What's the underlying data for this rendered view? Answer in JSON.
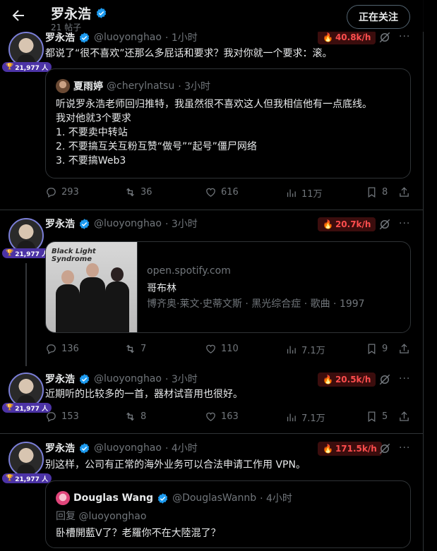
{
  "header": {
    "title": "罗永浩",
    "post_count": "21 帖子",
    "follow_label": "正在关注"
  },
  "colors": {
    "verified": "#1d9bf0",
    "hot_text": "#ff4d4d",
    "badge": "#4c33a6"
  },
  "tweets": [
    {
      "name": "罗永浩",
      "handle": "@luoyonghao",
      "time": "· 1小时",
      "hot": "40.8k/h",
      "badge": "21,977 人",
      "text": "都说了“很不喜欢”还那么多屁话和要求？我对你就一个要求：滚。",
      "quote": {
        "name": "夏雨婷",
        "handle": "@cherylnatsu",
        "time": "· 3小时",
        "lines": [
          "听说罗永浩老师回归推特，我虽然很不喜欢这人但我相信他有一点底线。",
          "我对他就3个要求",
          "1. 不要卖中转站",
          "2. 不要搞互关互粉互赞“做号”“起号”僵尸网络",
          "3. 不要搞Web3"
        ]
      },
      "stats": {
        "replies": "293",
        "retweets": "36",
        "likes": "616",
        "views": "11万"
      }
    },
    {
      "name": "罗永浩",
      "handle": "@luoyonghao",
      "time": "· 3小时",
      "hot": "20.7k/h",
      "badge": "21,977 人",
      "card": {
        "domain": "open.spotify.com",
        "title": "哥布林",
        "desc": "博齐奥·莱文·史蒂文斯 · 黑光综合症 · 歌曲 · 1997",
        "cover_text": "Black Light Syndrome"
      },
      "stats": {
        "replies": "136",
        "retweets": "7",
        "likes": "110",
        "views": "7.1万",
        "bookmarks": "9"
      }
    },
    {
      "name": "罗永浩",
      "handle": "@luoyonghao",
      "time": "· 3小时",
      "hot": "20.5k/h",
      "badge": "21,977 人",
      "text": "近期听的比较多的一首，器材试音用也很好。",
      "stats": {
        "replies": "153",
        "retweets": "8",
        "likes": "163",
        "views": "7.1万",
        "bookmarks": "5"
      }
    },
    {
      "name": "罗永浩",
      "handle": "@luoyonghao",
      "time": "· 4小时",
      "hot": "171.5k/h",
      "badge": "21,977 人",
      "text": "别这样，公司有正常的海外业务可以合法申请工作用 VPN。",
      "quote": {
        "name": "Douglas Wang",
        "handle": "@DouglasWannb",
        "time": "· 4小时",
        "reply_to": "回复 @luoyonghao",
        "text": "卧槽開藍V了？老羅你不在大陸混了？"
      }
    }
  ],
  "icons": [
    "back-arrow-icon",
    "verified-icon",
    "fire-icon",
    "grok-slash-icon",
    "more-icon",
    "reply-icon",
    "retweet-icon",
    "like-icon",
    "views-icon",
    "bookmark-icon",
    "share-icon",
    "trophy-icon"
  ]
}
